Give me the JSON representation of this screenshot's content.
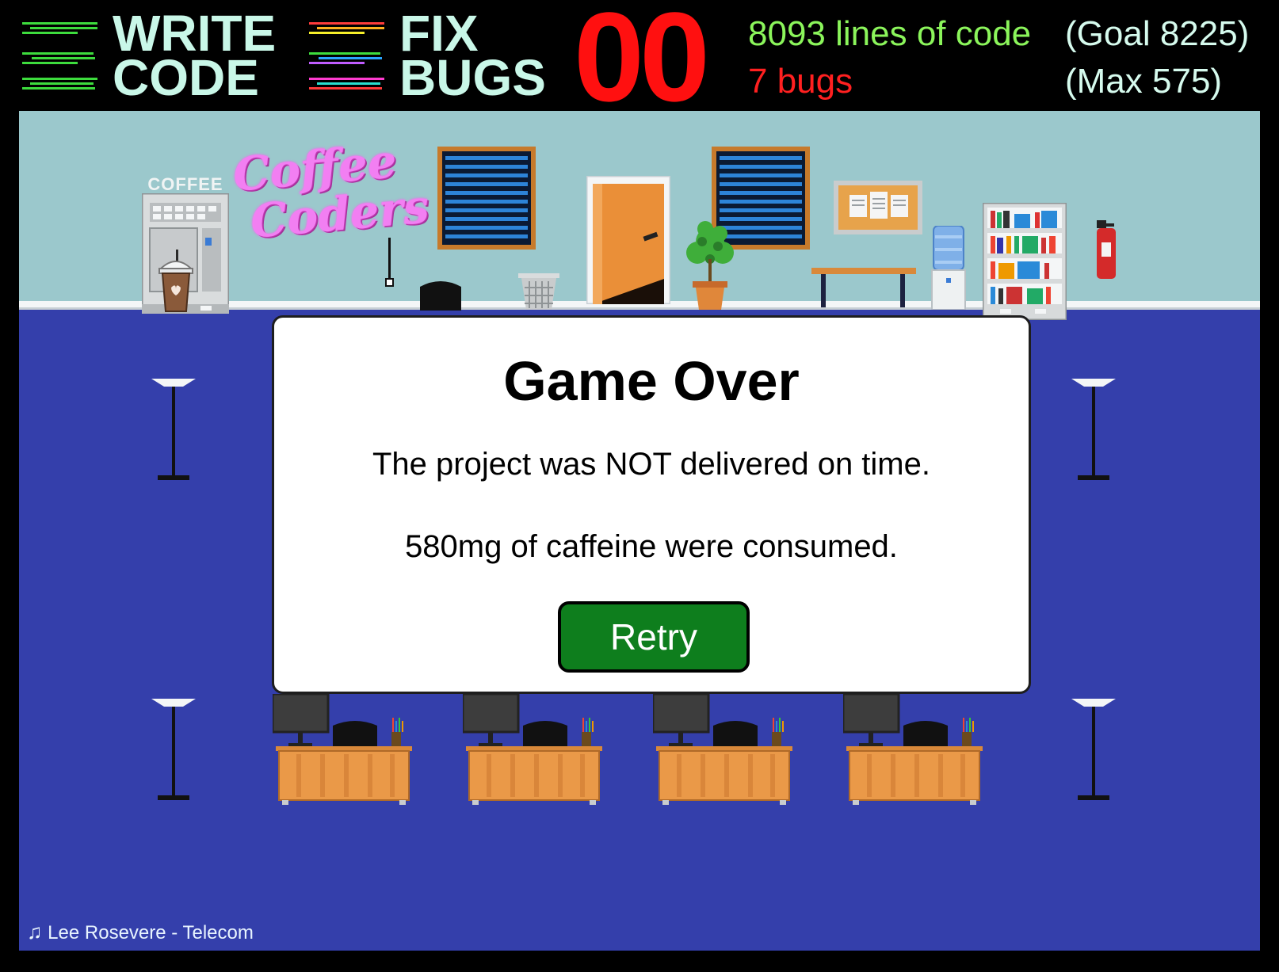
{
  "hud": {
    "write_code": {
      "line1": "WRITE",
      "line2": "CODE"
    },
    "fix_bugs": {
      "line1": "FIX",
      "line2": "BUGS"
    },
    "timer": "00",
    "lines_of_code": "8093 lines of code",
    "goal": "(Goal 8225)",
    "bugs": "7 bugs",
    "max": "(Max 575)"
  },
  "office": {
    "coffee_machine_label": "COFFEE",
    "neon_sign": {
      "line1": "Coffee",
      "line2": "Coders"
    }
  },
  "modal": {
    "title": "Game Over",
    "message": "The project was NOT delivered on time.",
    "caffeine": "580mg of caffeine were consumed.",
    "retry_label": "Retry"
  },
  "music_credit": "Lee Rosevere - Telecom",
  "colors": {
    "wall": "#9bc8cc",
    "floor": "#343fab",
    "timer": "#ff1010",
    "lines": "#8bf55b",
    "bugs": "#ff2020",
    "retry": "#0e7e1d"
  }
}
